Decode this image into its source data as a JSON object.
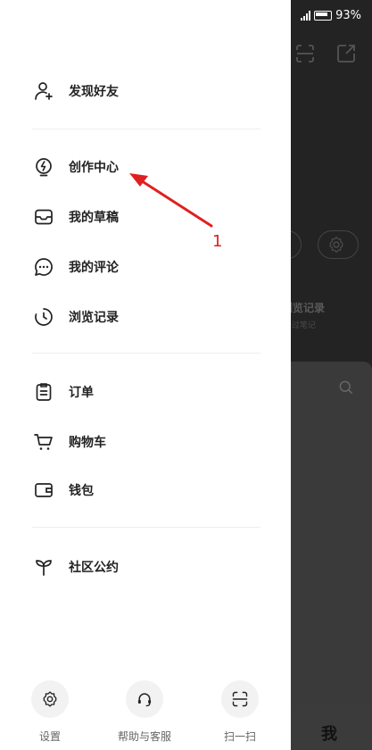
{
  "status": {
    "battery": "93%"
  },
  "drawer": {
    "items": [
      {
        "label": "发现好友",
        "icon": "add-friend-icon"
      },
      {
        "label": "创作中心",
        "icon": "lightning-bulb-icon"
      },
      {
        "label": "我的草稿",
        "icon": "inbox-tray-icon"
      },
      {
        "label": "我的评论",
        "icon": "comment-bubble-icon"
      },
      {
        "label": "浏览记录",
        "icon": "history-clock-icon"
      },
      {
        "label": "订单",
        "icon": "clipboard-order-icon"
      },
      {
        "label": "购物车",
        "icon": "shopping-cart-icon"
      },
      {
        "label": "钱包",
        "icon": "wallet-icon"
      },
      {
        "label": "社区公约",
        "icon": "sprout-icon"
      }
    ],
    "bottom": [
      {
        "label": "设置",
        "icon": "gear-icon"
      },
      {
        "label": "帮助与客服",
        "icon": "headset-icon"
      },
      {
        "label": "扫一扫",
        "icon": "scan-icon"
      }
    ]
  },
  "background": {
    "history_label": "浏览记录",
    "history_sub": "看过笔记",
    "tab_me": "我"
  },
  "annotation": {
    "label": "1",
    "color": "#e02020"
  }
}
